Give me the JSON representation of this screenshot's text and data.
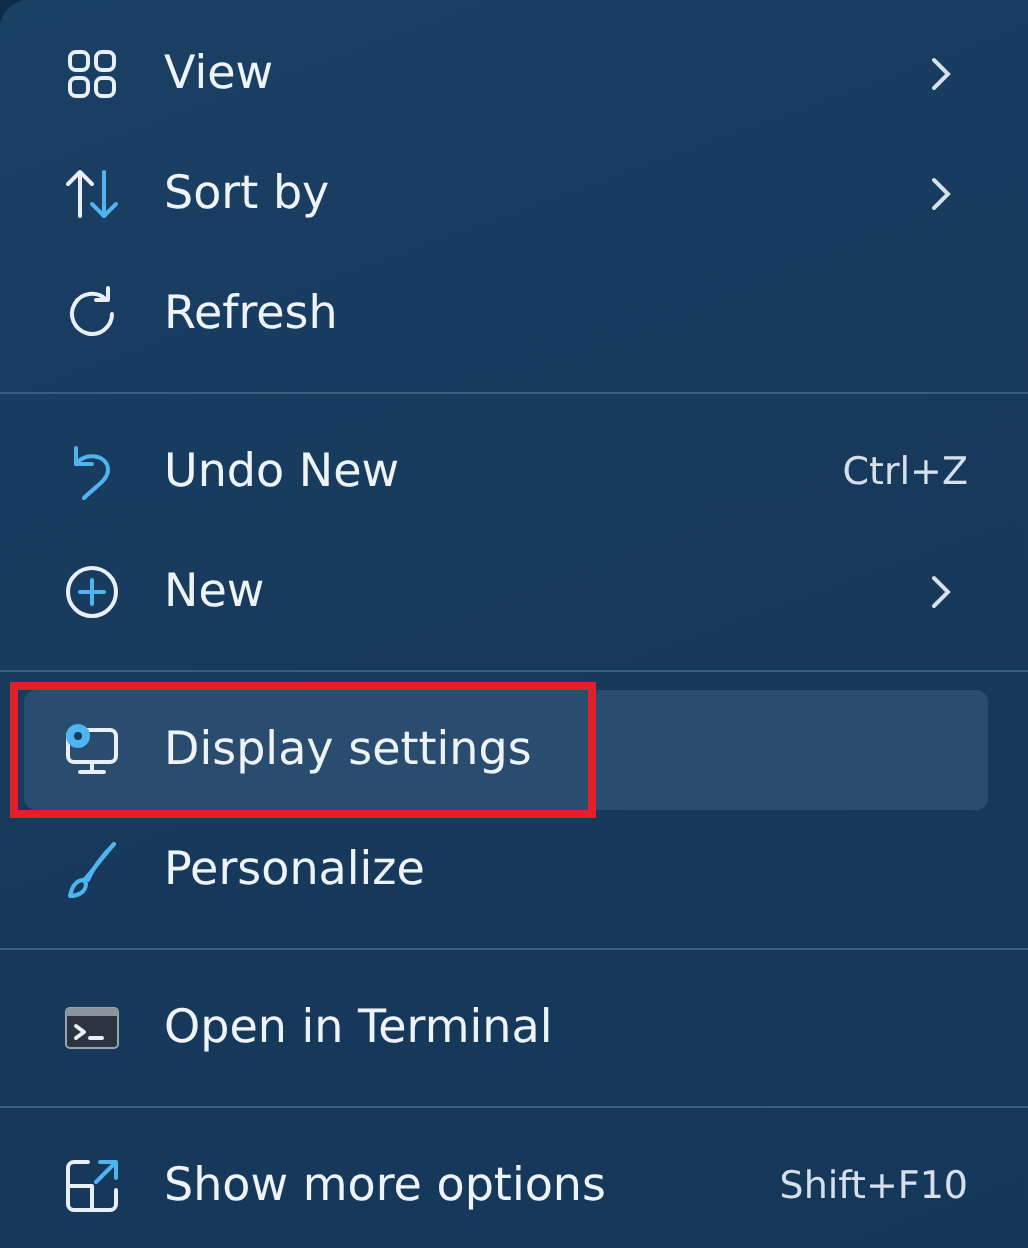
{
  "menu": {
    "sections": [
      {
        "items": [
          {
            "kind": "grid",
            "label": "View",
            "submenu": true,
            "selected": false,
            "annotated": false
          },
          {
            "kind": "sort",
            "label": "Sort by",
            "submenu": true,
            "selected": false,
            "annotated": false
          },
          {
            "kind": "refresh",
            "label": "Refresh",
            "submenu": false,
            "selected": false,
            "annotated": false
          }
        ]
      },
      {
        "items": [
          {
            "kind": "undo",
            "label": "Undo New",
            "shortcut": "Ctrl+Z",
            "submenu": false,
            "selected": false,
            "annotated": false
          },
          {
            "kind": "plus",
            "label": "New",
            "submenu": true,
            "selected": false,
            "annotated": false
          }
        ]
      },
      {
        "items": [
          {
            "kind": "display",
            "label": "Display settings",
            "submenu": false,
            "selected": true,
            "annotated": true
          },
          {
            "kind": "brush",
            "label": "Personalize",
            "submenu": false,
            "selected": false,
            "annotated": false
          }
        ]
      },
      {
        "items": [
          {
            "kind": "terminal",
            "label": "Open in Terminal",
            "submenu": false,
            "selected": false,
            "annotated": false
          }
        ]
      },
      {
        "items": [
          {
            "kind": "expand",
            "label": "Show more options",
            "shortcut": "Shift+F10",
            "submenu": false,
            "selected": false,
            "annotated": false
          }
        ]
      }
    ]
  }
}
